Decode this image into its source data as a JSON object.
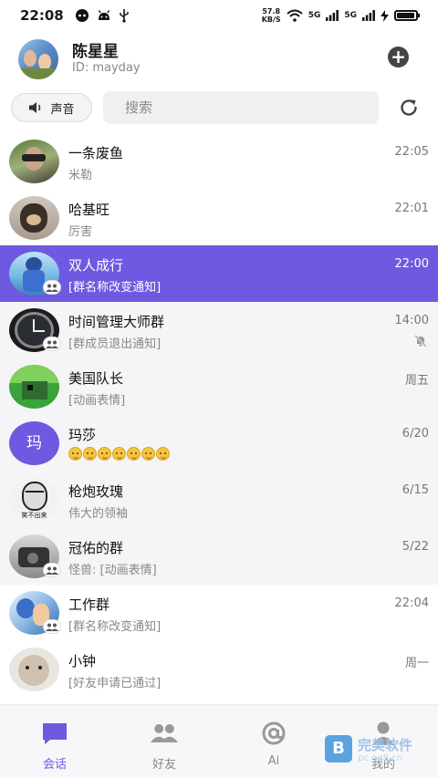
{
  "status_bar": {
    "time": "22:08",
    "net_speed_value": "57.8",
    "net_speed_unit": "KB/S",
    "signal1": "5G",
    "signal2": "5G"
  },
  "profile": {
    "name": "陈星星",
    "id": "ID: mayday"
  },
  "toolbar": {
    "sound_label": "声音",
    "search_placeholder": "搜索"
  },
  "conversations": [
    {
      "title": "一条废鱼",
      "subtitle": "米勒",
      "time": "22:05",
      "group": false,
      "muted": false
    },
    {
      "title": "哈基旺",
      "subtitle": "厉害",
      "time": "22:01",
      "group": false,
      "muted": false
    },
    {
      "title": "双人成行",
      "subtitle": "[群名称改变通知]",
      "time": "22:00",
      "group": true,
      "muted": false,
      "active": true
    },
    {
      "title": "时间管理大师群",
      "subtitle": "[群成员退出通知]",
      "time": "14:00",
      "group": true,
      "muted": true
    },
    {
      "title": "美国队长",
      "subtitle": "[动画表情]",
      "time": "周五",
      "group": false,
      "muted": false
    },
    {
      "title": "玛莎",
      "subtitle": "",
      "time": "6/20",
      "group": false,
      "muted": false,
      "avatar_text": "玛"
    },
    {
      "title": "枪炮玫瑰",
      "subtitle": "伟大的领袖",
      "time": "6/15",
      "group": false,
      "muted": false,
      "avatar_text": "笑不出来"
    },
    {
      "title": "冠佑的群",
      "subtitle": "怪兽: [动画表情]",
      "time": "5/22",
      "group": true,
      "muted": false
    },
    {
      "title": "工作群",
      "subtitle": "[群名称改变通知]",
      "time": "22:04",
      "group": true,
      "muted": false
    },
    {
      "title": "小钟",
      "subtitle": "[好友申请已通过]",
      "time": "周一",
      "group": false,
      "muted": false
    }
  ],
  "tabs": [
    {
      "label": "会话",
      "icon": "chat-bubble-icon",
      "active": true
    },
    {
      "label": "好友",
      "icon": "friends-icon",
      "active": false
    },
    {
      "label": "Ai",
      "icon": "at-sign-icon",
      "active": false
    },
    {
      "label": "我的",
      "icon": "profile-icon",
      "active": false
    }
  ],
  "watermark": {
    "logo_text": "B",
    "text": "完美软件",
    "url": "pc.qq8.cn"
  },
  "colors": {
    "accent": "#6d5ae0",
    "muted_text": "#888888",
    "row_shade": "#f5f5f7"
  }
}
